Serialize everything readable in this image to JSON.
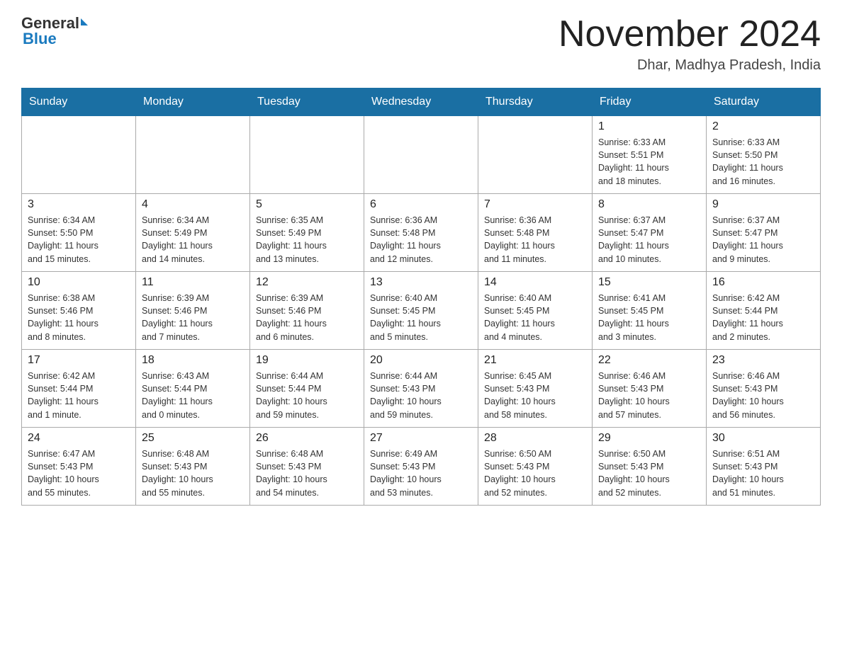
{
  "logo": {
    "text_general": "General",
    "text_blue": "Blue"
  },
  "header": {
    "month": "November 2024",
    "location": "Dhar, Madhya Pradesh, India"
  },
  "weekdays": [
    "Sunday",
    "Monday",
    "Tuesday",
    "Wednesday",
    "Thursday",
    "Friday",
    "Saturday"
  ],
  "weeks": [
    [
      {
        "day": "",
        "info": ""
      },
      {
        "day": "",
        "info": ""
      },
      {
        "day": "",
        "info": ""
      },
      {
        "day": "",
        "info": ""
      },
      {
        "day": "",
        "info": ""
      },
      {
        "day": "1",
        "info": "Sunrise: 6:33 AM\nSunset: 5:51 PM\nDaylight: 11 hours\nand 18 minutes."
      },
      {
        "day": "2",
        "info": "Sunrise: 6:33 AM\nSunset: 5:50 PM\nDaylight: 11 hours\nand 16 minutes."
      }
    ],
    [
      {
        "day": "3",
        "info": "Sunrise: 6:34 AM\nSunset: 5:50 PM\nDaylight: 11 hours\nand 15 minutes."
      },
      {
        "day": "4",
        "info": "Sunrise: 6:34 AM\nSunset: 5:49 PM\nDaylight: 11 hours\nand 14 minutes."
      },
      {
        "day": "5",
        "info": "Sunrise: 6:35 AM\nSunset: 5:49 PM\nDaylight: 11 hours\nand 13 minutes."
      },
      {
        "day": "6",
        "info": "Sunrise: 6:36 AM\nSunset: 5:48 PM\nDaylight: 11 hours\nand 12 minutes."
      },
      {
        "day": "7",
        "info": "Sunrise: 6:36 AM\nSunset: 5:48 PM\nDaylight: 11 hours\nand 11 minutes."
      },
      {
        "day": "8",
        "info": "Sunrise: 6:37 AM\nSunset: 5:47 PM\nDaylight: 11 hours\nand 10 minutes."
      },
      {
        "day": "9",
        "info": "Sunrise: 6:37 AM\nSunset: 5:47 PM\nDaylight: 11 hours\nand 9 minutes."
      }
    ],
    [
      {
        "day": "10",
        "info": "Sunrise: 6:38 AM\nSunset: 5:46 PM\nDaylight: 11 hours\nand 8 minutes."
      },
      {
        "day": "11",
        "info": "Sunrise: 6:39 AM\nSunset: 5:46 PM\nDaylight: 11 hours\nand 7 minutes."
      },
      {
        "day": "12",
        "info": "Sunrise: 6:39 AM\nSunset: 5:46 PM\nDaylight: 11 hours\nand 6 minutes."
      },
      {
        "day": "13",
        "info": "Sunrise: 6:40 AM\nSunset: 5:45 PM\nDaylight: 11 hours\nand 5 minutes."
      },
      {
        "day": "14",
        "info": "Sunrise: 6:40 AM\nSunset: 5:45 PM\nDaylight: 11 hours\nand 4 minutes."
      },
      {
        "day": "15",
        "info": "Sunrise: 6:41 AM\nSunset: 5:45 PM\nDaylight: 11 hours\nand 3 minutes."
      },
      {
        "day": "16",
        "info": "Sunrise: 6:42 AM\nSunset: 5:44 PM\nDaylight: 11 hours\nand 2 minutes."
      }
    ],
    [
      {
        "day": "17",
        "info": "Sunrise: 6:42 AM\nSunset: 5:44 PM\nDaylight: 11 hours\nand 1 minute."
      },
      {
        "day": "18",
        "info": "Sunrise: 6:43 AM\nSunset: 5:44 PM\nDaylight: 11 hours\nand 0 minutes."
      },
      {
        "day": "19",
        "info": "Sunrise: 6:44 AM\nSunset: 5:44 PM\nDaylight: 10 hours\nand 59 minutes."
      },
      {
        "day": "20",
        "info": "Sunrise: 6:44 AM\nSunset: 5:43 PM\nDaylight: 10 hours\nand 59 minutes."
      },
      {
        "day": "21",
        "info": "Sunrise: 6:45 AM\nSunset: 5:43 PM\nDaylight: 10 hours\nand 58 minutes."
      },
      {
        "day": "22",
        "info": "Sunrise: 6:46 AM\nSunset: 5:43 PM\nDaylight: 10 hours\nand 57 minutes."
      },
      {
        "day": "23",
        "info": "Sunrise: 6:46 AM\nSunset: 5:43 PM\nDaylight: 10 hours\nand 56 minutes."
      }
    ],
    [
      {
        "day": "24",
        "info": "Sunrise: 6:47 AM\nSunset: 5:43 PM\nDaylight: 10 hours\nand 55 minutes."
      },
      {
        "day": "25",
        "info": "Sunrise: 6:48 AM\nSunset: 5:43 PM\nDaylight: 10 hours\nand 55 minutes."
      },
      {
        "day": "26",
        "info": "Sunrise: 6:48 AM\nSunset: 5:43 PM\nDaylight: 10 hours\nand 54 minutes."
      },
      {
        "day": "27",
        "info": "Sunrise: 6:49 AM\nSunset: 5:43 PM\nDaylight: 10 hours\nand 53 minutes."
      },
      {
        "day": "28",
        "info": "Sunrise: 6:50 AM\nSunset: 5:43 PM\nDaylight: 10 hours\nand 52 minutes."
      },
      {
        "day": "29",
        "info": "Sunrise: 6:50 AM\nSunset: 5:43 PM\nDaylight: 10 hours\nand 52 minutes."
      },
      {
        "day": "30",
        "info": "Sunrise: 6:51 AM\nSunset: 5:43 PM\nDaylight: 10 hours\nand 51 minutes."
      }
    ]
  ]
}
